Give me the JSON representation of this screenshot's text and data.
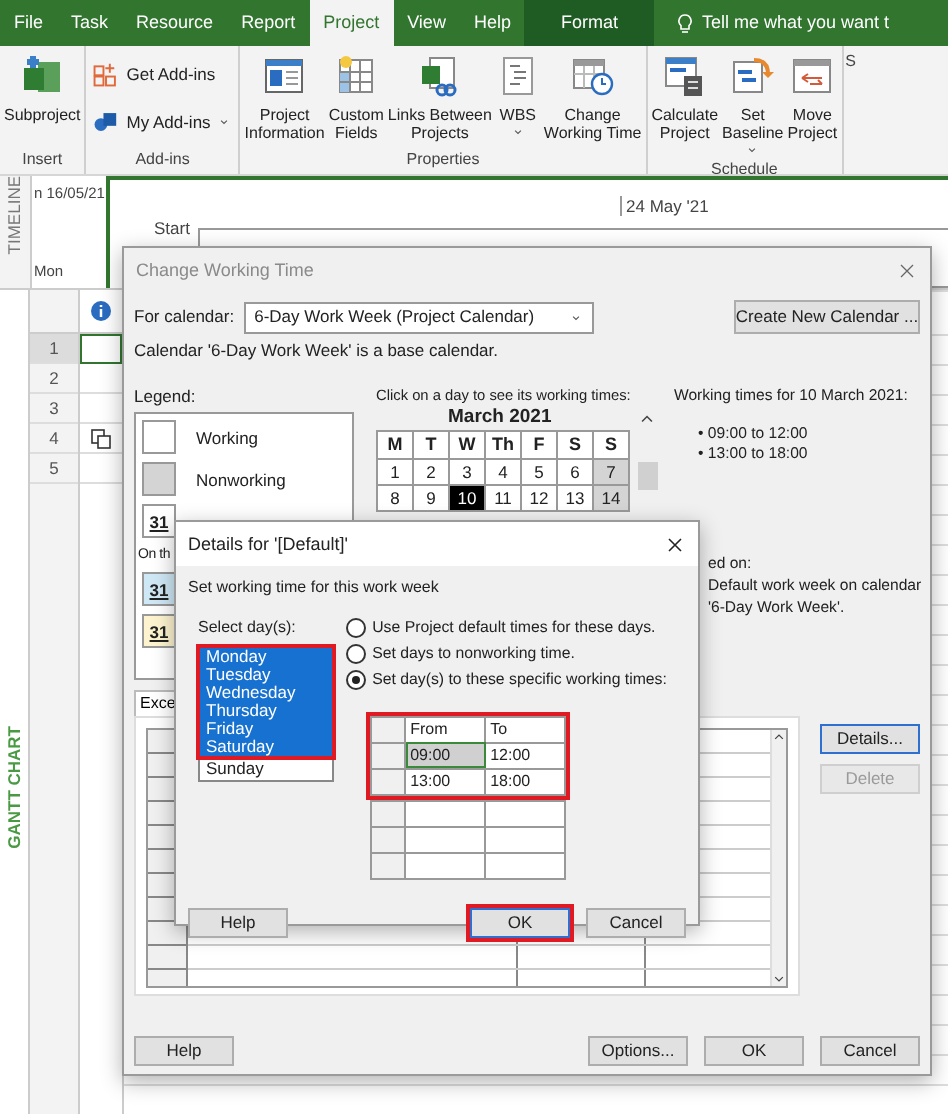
{
  "ribbon": {
    "tabs": [
      {
        "label": "File",
        "selected": false,
        "kind": "normal"
      },
      {
        "label": "Task",
        "selected": false,
        "kind": "normal"
      },
      {
        "label": "Resource",
        "selected": false,
        "kind": "normal"
      },
      {
        "label": "Report",
        "selected": false,
        "kind": "normal"
      },
      {
        "label": "Project",
        "selected": true,
        "kind": "normal"
      },
      {
        "label": "View",
        "selected": false,
        "kind": "normal"
      },
      {
        "label": "Help",
        "selected": false,
        "kind": "normal"
      },
      {
        "label": "Format",
        "selected": false,
        "kind": "contextual"
      }
    ],
    "tell_me": "Tell me what you want t",
    "groups": [
      {
        "label": "Insert",
        "commands": [
          {
            "lines": [
              "Subproject"
            ],
            "kind": "large"
          }
        ]
      },
      {
        "label": "Add-ins",
        "commands": [
          {
            "lines": [
              "Get Add-ins"
            ],
            "kind": "small"
          },
          {
            "lines": [
              "My Add-ins"
            ],
            "kind": "small",
            "dropdown": true
          }
        ]
      },
      {
        "label": "Properties",
        "commands": [
          {
            "lines": [
              "Project",
              "Information"
            ],
            "kind": "large"
          },
          {
            "lines": [
              "Custom",
              "Fields"
            ],
            "kind": "large"
          },
          {
            "lines": [
              "Links Between",
              "Projects"
            ],
            "kind": "large"
          },
          {
            "lines": [
              "WBS"
            ],
            "kind": "large",
            "dropdown": true
          },
          {
            "lines": [
              "Change",
              "Working Time"
            ],
            "kind": "large"
          }
        ]
      },
      {
        "label": "Schedule",
        "commands": [
          {
            "lines": [
              "Calculate",
              "Project"
            ],
            "kind": "large"
          },
          {
            "lines": [
              "Set",
              "Baseline"
            ],
            "kind": "large",
            "dropdown": true
          },
          {
            "lines": [
              "Move",
              "Project"
            ],
            "kind": "large"
          }
        ]
      }
    ],
    "overflow_label": "S"
  },
  "timeline": {
    "label": "TIMELINE",
    "left_date": "n 16/05/21",
    "start_label": "Start",
    "start_date": "Mon",
    "marker": "24 May '21"
  },
  "gantt": {
    "label": "GANTT CHART",
    "rows": [
      {
        "id": "1",
        "selected": true,
        "indicator": false
      },
      {
        "id": "2",
        "selected": false,
        "indicator": false
      },
      {
        "id": "3",
        "selected": false,
        "indicator": false
      },
      {
        "id": "4",
        "selected": false,
        "indicator": true
      },
      {
        "id": "5",
        "selected": false,
        "indicator": false
      }
    ]
  },
  "change_working_time": {
    "title": "Change Working Time",
    "for_calendar_label": "For calendar:",
    "calendar_value": "6-Day Work Week (Project Calendar)",
    "create_button": "Create New Calendar ...",
    "base_note": "Calendar '6-Day Work Week' is a base calendar.",
    "legend_title": "Legend:",
    "legend": [
      {
        "kind": "working",
        "text": "Working"
      },
      {
        "kind": "nonworking",
        "text": "Nonworking"
      },
      {
        "kind": "edited",
        "text": "31"
      },
      {
        "kind": "caption",
        "text": "On th"
      },
      {
        "kind": "exception",
        "text": "31"
      },
      {
        "kind": "nondefault",
        "text": "31"
      }
    ],
    "calendar": {
      "prompt": "Click on a day to see its working times:",
      "month": "March 2021",
      "weekdays": [
        "M",
        "T",
        "W",
        "Th",
        "F",
        "S",
        "S"
      ],
      "weeks": [
        [
          {
            "day": "1",
            "selected": false,
            "nonworking": false
          },
          {
            "day": "2",
            "selected": false,
            "nonworking": false
          },
          {
            "day": "3",
            "selected": false,
            "nonworking": false
          },
          {
            "day": "4",
            "selected": false,
            "nonworking": false
          },
          {
            "day": "5",
            "selected": false,
            "nonworking": false
          },
          {
            "day": "6",
            "selected": false,
            "nonworking": false
          },
          {
            "day": "7",
            "selected": false,
            "nonworking": true
          }
        ],
        [
          {
            "day": "8",
            "selected": false,
            "nonworking": false
          },
          {
            "day": "9",
            "selected": false,
            "nonworking": false
          },
          {
            "day": "10",
            "selected": true,
            "nonworking": false
          },
          {
            "day": "11",
            "selected": false,
            "nonworking": false
          },
          {
            "day": "12",
            "selected": false,
            "nonworking": false
          },
          {
            "day": "13",
            "selected": false,
            "nonworking": false
          },
          {
            "day": "14",
            "selected": false,
            "nonworking": true
          }
        ]
      ]
    },
    "working_times": {
      "title": "Working times for 10 March 2021:",
      "entries": [
        "• 09:00 to 12:00",
        "• 13:00 to 18:00"
      ]
    },
    "based_on": [
      "ed on:",
      "Default work week on calendar",
      "'6-Day Work Week'."
    ],
    "tabs": [
      {
        "label": "Exce",
        "selected": true
      }
    ],
    "side_buttons": [
      {
        "label": "Details...",
        "disabled": false
      },
      {
        "label": "Delete",
        "disabled": true
      }
    ],
    "footer_buttons": [
      {
        "label": "Help"
      },
      {
        "label": "Options..."
      },
      {
        "label": "OK"
      },
      {
        "label": "Cancel"
      }
    ]
  },
  "details": {
    "title": "Details for '[Default]'",
    "heading": "Set working time for this work week",
    "days_label": "Select day(s):",
    "days": [
      {
        "label": "Monday",
        "selected": true
      },
      {
        "label": "Tuesday",
        "selected": true
      },
      {
        "label": "Wednesday",
        "selected": true
      },
      {
        "label": "Thursday",
        "selected": true
      },
      {
        "label": "Friday",
        "selected": true
      },
      {
        "label": "Saturday",
        "selected": true
      },
      {
        "label": "Sunday",
        "selected": false
      }
    ],
    "days_highlighted": true,
    "options": [
      {
        "label": "Use Project default times for these days.",
        "selected": false
      },
      {
        "label": "Set days to nonworking time.",
        "selected": false
      },
      {
        "label": "Set day(s) to these specific working times:",
        "selected": true
      }
    ],
    "times": {
      "columns": [
        "From",
        "To"
      ],
      "highlighted": true,
      "rows": [
        [
          {
            "text": "09:00",
            "selected": true
          },
          {
            "text": "12:00",
            "selected": false
          }
        ],
        [
          {
            "text": "13:00",
            "selected": false
          },
          {
            "text": "18:00",
            "selected": false
          }
        ]
      ]
    },
    "buttons": [
      {
        "label": "Help",
        "highlighted": false
      },
      {
        "label": "OK",
        "highlighted": true
      },
      {
        "label": "Cancel",
        "highlighted": false
      }
    ]
  }
}
